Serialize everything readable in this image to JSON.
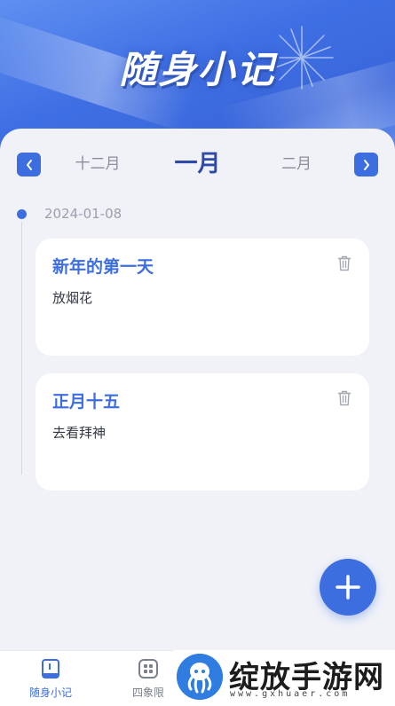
{
  "app": {
    "title": "随身小记"
  },
  "month_nav": {
    "prev_month": "十二月",
    "current_month": "一月",
    "next_month": "二月"
  },
  "timeline": {
    "date": "2024-01-08"
  },
  "notes": [
    {
      "title": "新年的第一天",
      "body": "放烟花"
    },
    {
      "title": "正月十五",
      "body": "去看拜神"
    }
  ],
  "tabbar": {
    "items": [
      {
        "label": "随身小记",
        "icon": "notebook-icon",
        "active": true
      },
      {
        "label": "四象限",
        "icon": "quadrant-icon",
        "active": false
      }
    ]
  },
  "watermark": {
    "text": "绽放手游网",
    "url": "www.gxhuaer.com"
  },
  "colors": {
    "accent": "#3d6ee0",
    "hero": "#4a78e6",
    "background": "#f0f2f8"
  }
}
